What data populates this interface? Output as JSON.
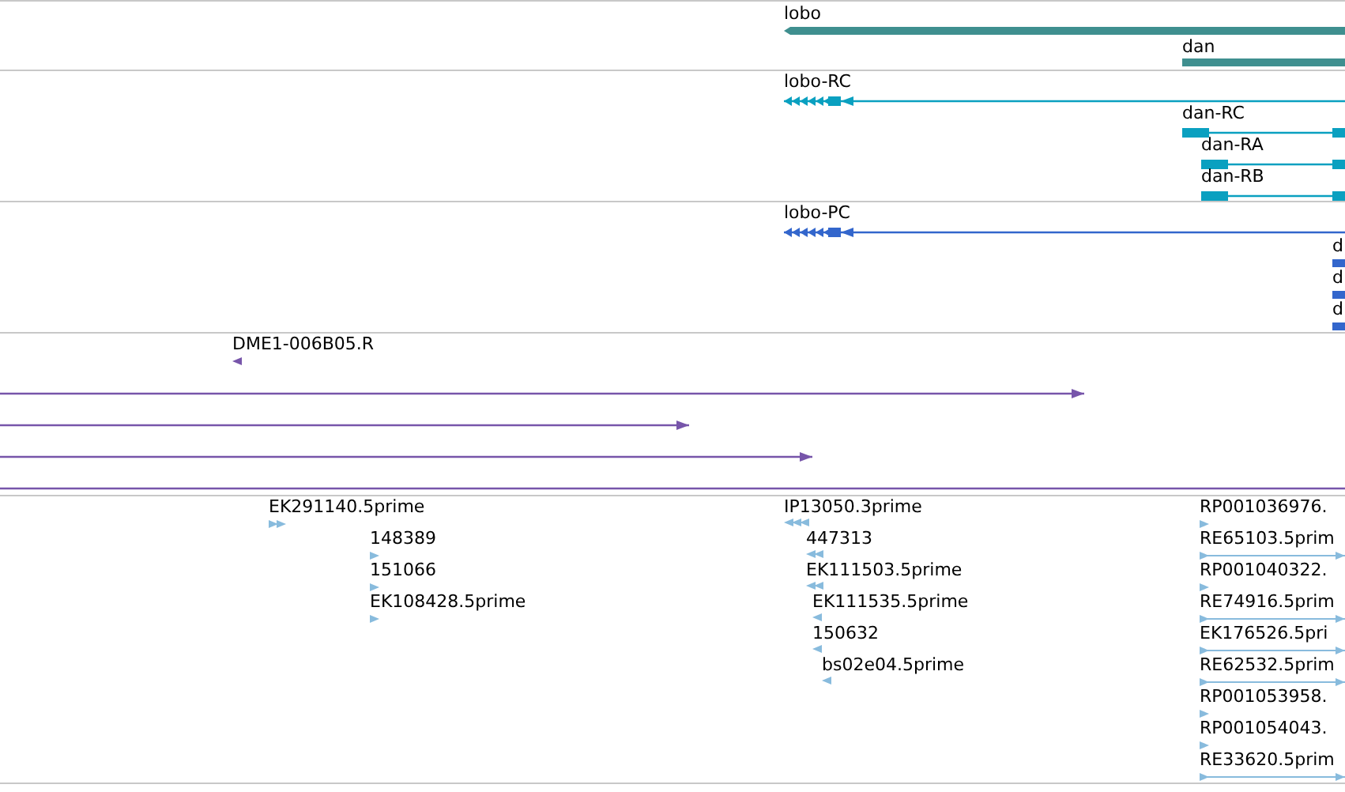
{
  "tracks": [
    {
      "color": "#3f8f8f",
      "features": [
        {
          "kind": "gene",
          "label": "lobo",
          "reverse": true
        },
        {
          "kind": "gene",
          "label": "dan",
          "reverse": false
        }
      ]
    },
    {
      "color": "#0aa0c0",
      "features": [
        {
          "kind": "transcript",
          "label": "lobo-RC",
          "reverse": true
        },
        {
          "kind": "transcript",
          "label": "dan-RC",
          "reverse": false
        },
        {
          "kind": "transcript",
          "label": "dan-RA",
          "reverse": false
        },
        {
          "kind": "transcript",
          "label": "dan-RB",
          "reverse": false
        }
      ]
    },
    {
      "color": "#3366cc",
      "features": [
        {
          "kind": "transcript",
          "label": "lobo-PC",
          "reverse": true
        },
        {
          "kind": "gene",
          "label": "d",
          "reverse": false
        },
        {
          "kind": "gene",
          "label": "d",
          "reverse": false
        },
        {
          "kind": "gene",
          "label": "d",
          "reverse": false
        }
      ]
    },
    {
      "color": "#7755aa",
      "features": [
        {
          "kind": "est",
          "label": "DME1-006B05.R",
          "reverse": true
        },
        {
          "kind": "read",
          "reverse": false
        },
        {
          "kind": "read",
          "reverse": false
        },
        {
          "kind": "read",
          "reverse": false
        },
        {
          "kind": "read",
          "reverse": false
        }
      ]
    },
    {
      "color": "#88bbdd",
      "features": [
        {
          "kind": "est",
          "label": "EK291140.5prime",
          "reverse": false
        },
        {
          "kind": "est",
          "label": "148389",
          "reverse": false
        },
        {
          "kind": "est",
          "label": "151066",
          "reverse": false
        },
        {
          "kind": "est",
          "label": "EK108428.5prime",
          "reverse": false
        },
        {
          "kind": "est",
          "label": "IP13050.3prime",
          "reverse": true
        },
        {
          "kind": "est",
          "label": "447313",
          "reverse": true
        },
        {
          "kind": "est",
          "label": "EK111503.5prime",
          "reverse": true
        },
        {
          "kind": "est",
          "label": "EK111535.5prime",
          "reverse": true
        },
        {
          "kind": "est",
          "label": "150632",
          "reverse": true
        },
        {
          "kind": "est",
          "label": "bs02e04.5prime",
          "reverse": true
        },
        {
          "kind": "est",
          "label": "RP001036976.",
          "reverse": false
        },
        {
          "kind": "est",
          "label": "RE65103.5prim",
          "reverse": false
        },
        {
          "kind": "est",
          "label": "RP001040322.",
          "reverse": false
        },
        {
          "kind": "est",
          "label": "RE74916.5prim",
          "reverse": false
        },
        {
          "kind": "est",
          "label": "EK176526.5pri",
          "reverse": false
        },
        {
          "kind": "est",
          "label": "RE62532.5prim",
          "reverse": false
        },
        {
          "kind": "est",
          "label": "RP001053958.",
          "reverse": false
        },
        {
          "kind": "est",
          "label": "RP001054043.",
          "reverse": false
        },
        {
          "kind": "est",
          "label": "RE33620.5prim",
          "reverse": false
        }
      ]
    }
  ]
}
